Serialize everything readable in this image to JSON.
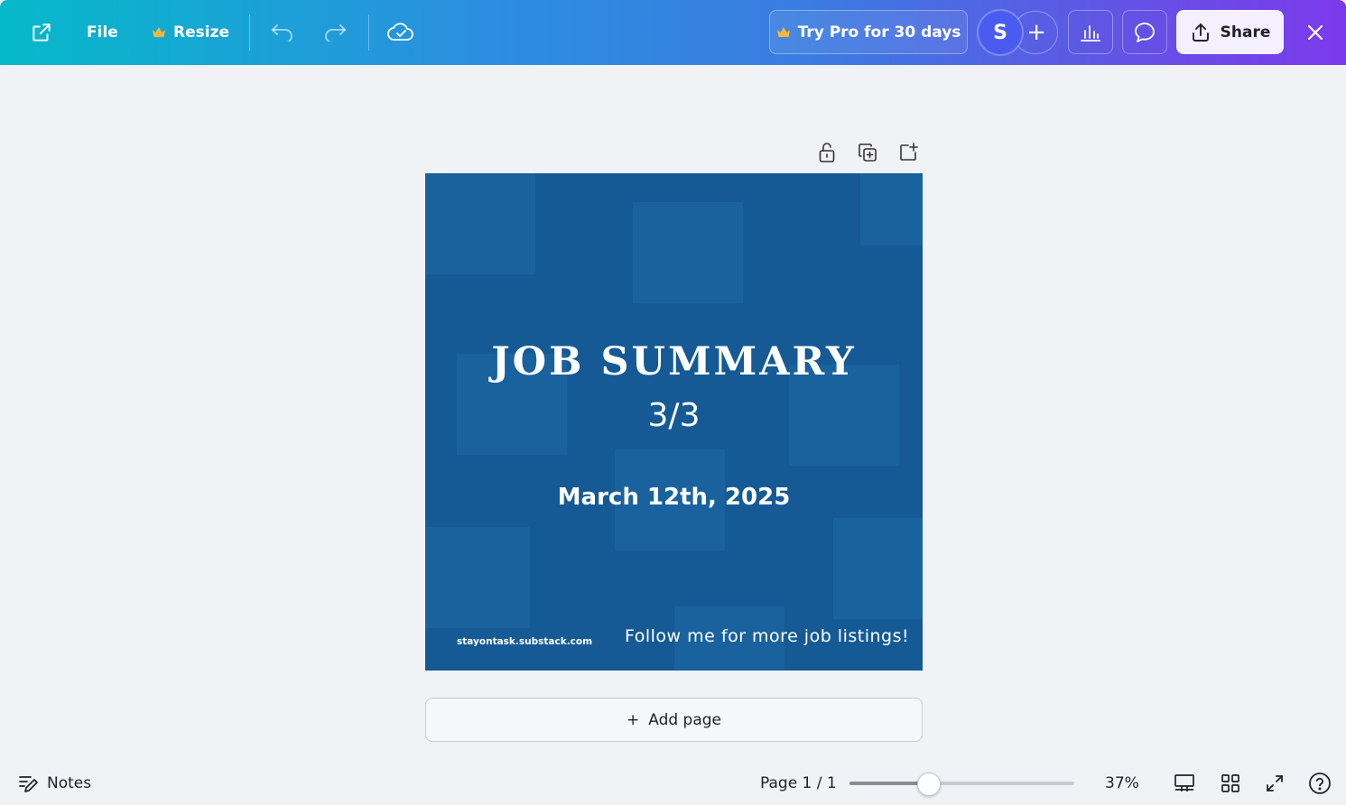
{
  "colors": {
    "topbar_start": "#06b9c9",
    "topbar_end": "#7c3aed",
    "canvas_bg": "#155a95",
    "crown": "#f5b83d",
    "workspace_bg": "#f1f2f6"
  },
  "toolbar": {
    "open_external_icon": "external-link-icon",
    "file_label": "File",
    "resize_label": "Resize",
    "undo_icon": "undo-icon",
    "redo_icon": "redo-icon",
    "save_status_icon": "cloud-check-icon",
    "try_pro_label": "Try Pro for 30 days",
    "avatar_initial": "S",
    "add_collaborator_label": "+",
    "insights_icon": "bar-chart-icon",
    "comments_icon": "comment-icon",
    "share_label": "Share",
    "close_icon": "close-icon"
  },
  "page_tools": {
    "lock_icon": "lock-icon",
    "duplicate_icon": "duplicate-page-icon",
    "add_icon": "add-page-icon"
  },
  "design": {
    "title": "JOB SUMMARY",
    "subtitle": "3/3",
    "date": "March 12th, 2025",
    "website": "stayontask.substack.com",
    "cta": "Follow me for more job listings!"
  },
  "add_page": {
    "icon": "+",
    "label": "Add page"
  },
  "footer": {
    "notes_label": "Notes",
    "page_indicator": "Page 1 / 1",
    "zoom_label": "37%",
    "zoom_fraction": 0.35,
    "layout_icon": "layout-icon",
    "grid_icon": "grid-icon",
    "fullscreen_icon": "fullscreen-icon",
    "help_icon": "help-icon"
  }
}
